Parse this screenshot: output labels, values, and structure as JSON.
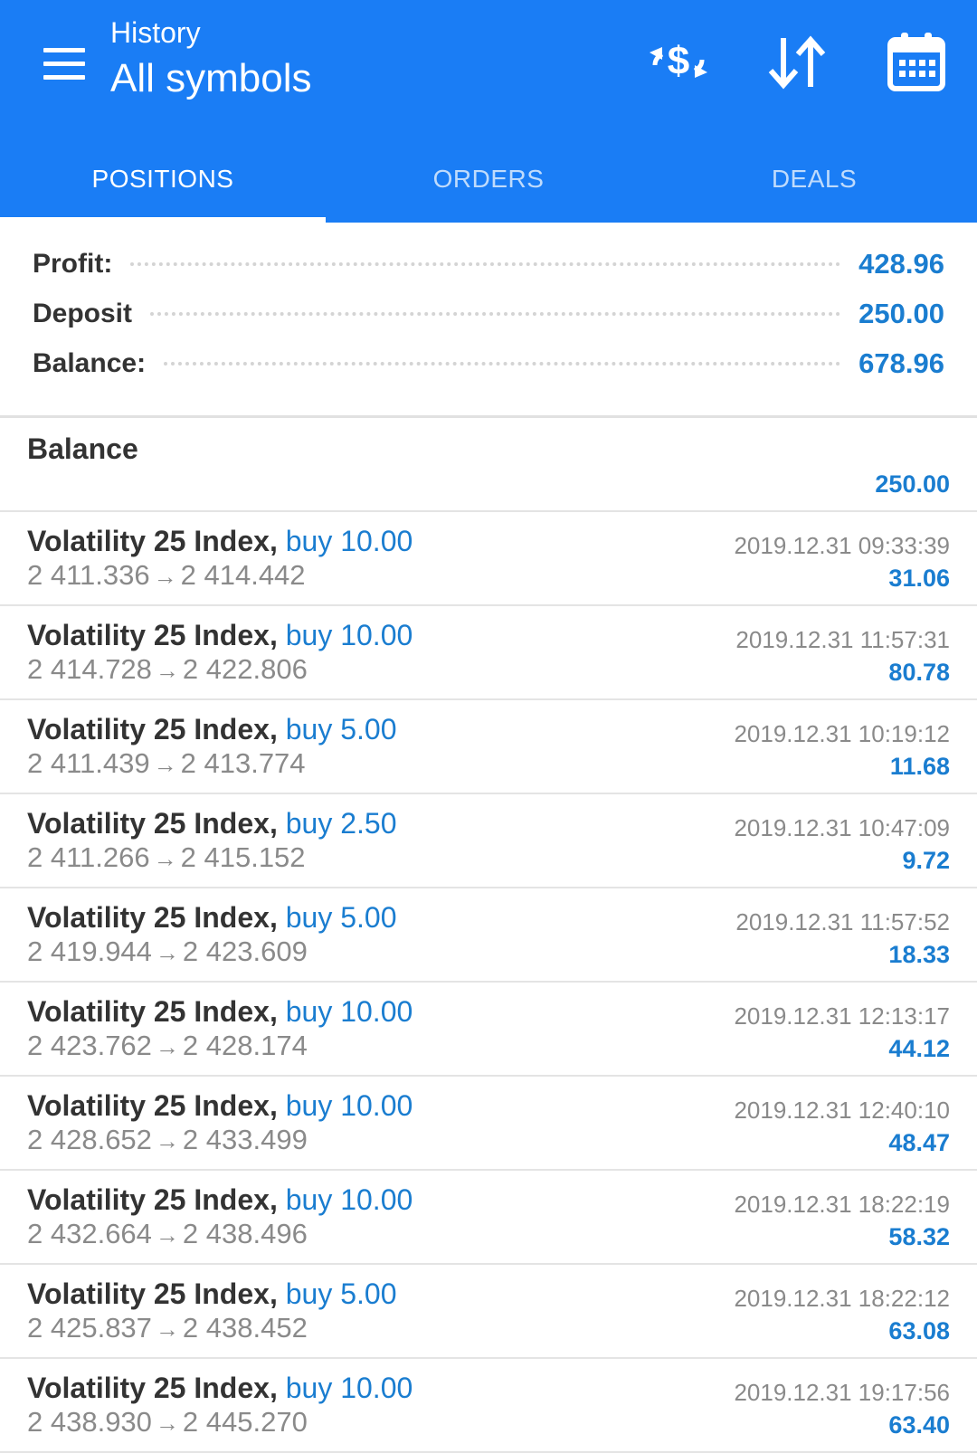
{
  "header": {
    "subtitle": "History",
    "title": "All symbols",
    "icons": [
      "menu-icon",
      "currency-exchange-icon",
      "sort-icon",
      "calendar-icon"
    ]
  },
  "tabs": [
    {
      "label": "POSITIONS",
      "active": true
    },
    {
      "label": "ORDERS",
      "active": false
    },
    {
      "label": "DEALS",
      "active": false
    }
  ],
  "summary": {
    "profit_label": "Profit:",
    "profit_value": "428.96",
    "deposit_label": "Deposit",
    "deposit_value": "250.00",
    "balance_label": "Balance:",
    "balance_value": "678.96"
  },
  "balance_entry": {
    "label": "Balance",
    "amount": "250.00"
  },
  "deals": [
    {
      "symbol": "Volatility 25 Index,",
      "side": "buy 10.00",
      "open": "2 411.336",
      "arrow": "→",
      "close": "2 414.442",
      "time": "2019.12.31 09:33:39",
      "profit": "31.06"
    },
    {
      "symbol": "Volatility 25 Index,",
      "side": "buy 10.00",
      "open": "2 414.728",
      "arrow": "→",
      "close": "2 422.806",
      "time": "2019.12.31 11:57:31",
      "profit": "80.78"
    },
    {
      "symbol": "Volatility 25 Index,",
      "side": "buy 5.00",
      "open": "2 411.439",
      "arrow": "→",
      "close": "2 413.774",
      "time": "2019.12.31 10:19:12",
      "profit": "11.68"
    },
    {
      "symbol": "Volatility 25 Index,",
      "side": "buy 2.50",
      "open": "2 411.266",
      "arrow": "→",
      "close": "2 415.152",
      "time": "2019.12.31 10:47:09",
      "profit": "9.72"
    },
    {
      "symbol": "Volatility 25 Index,",
      "side": "buy 5.00",
      "open": "2 419.944",
      "arrow": "→",
      "close": "2 423.609",
      "time": "2019.12.31 11:57:52",
      "profit": "18.33"
    },
    {
      "symbol": "Volatility 25 Index,",
      "side": "buy 10.00",
      "open": "2 423.762",
      "arrow": "→",
      "close": "2 428.174",
      "time": "2019.12.31 12:13:17",
      "profit": "44.12"
    },
    {
      "symbol": "Volatility 25 Index,",
      "side": "buy 10.00",
      "open": "2 428.652",
      "arrow": "→",
      "close": "2 433.499",
      "time": "2019.12.31 12:40:10",
      "profit": "48.47"
    },
    {
      "symbol": "Volatility 25 Index,",
      "side": "buy 10.00",
      "open": "2 432.664",
      "arrow": "→",
      "close": "2 438.496",
      "time": "2019.12.31 18:22:19",
      "profit": "58.32"
    },
    {
      "symbol": "Volatility 25 Index,",
      "side": "buy 5.00",
      "open": "2 425.837",
      "arrow": "→",
      "close": "2 438.452",
      "time": "2019.12.31 18:22:12",
      "profit": "63.08"
    },
    {
      "symbol": "Volatility 25 Index,",
      "side": "buy 10.00",
      "open": "2 438.930",
      "arrow": "→",
      "close": "2 445.270",
      "time": "2019.12.31 19:17:56",
      "profit": "63.40"
    }
  ],
  "colors": {
    "appbar": "#1a7df5",
    "accent_blue": "#1a7dd0",
    "muted_gray": "#8a8a8a"
  }
}
